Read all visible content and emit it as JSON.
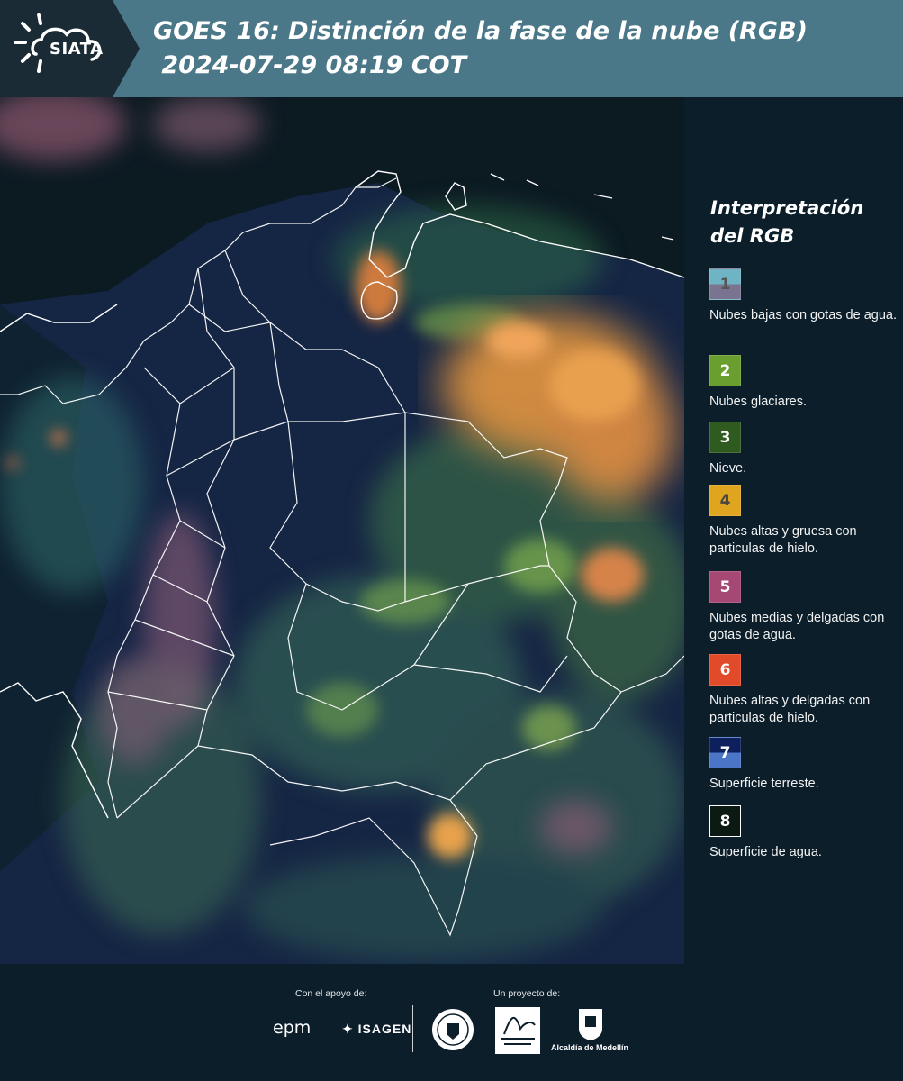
{
  "header": {
    "logo_text": "SIATA",
    "title_line1": "GOES 16: Distinción de la fase de la nube (RGB)",
    "title_line2": " 2024-07-29 08:19 COT",
    "background_color": "#4a7888"
  },
  "map": {
    "description_icon": "satellite-rgb-map",
    "palette": {
      "ocean": "#0c1a22",
      "land": "#1b2a48",
      "cloud_green": "#5c9a4c",
      "cloud_orange": "#e9a24a",
      "cloud_pink": "#a16a86",
      "border": "#ffffff"
    }
  },
  "legend": {
    "title": "Interpretación del RGB",
    "items": [
      {
        "number": "1",
        "label": "Nubes bajas con gotas de agua.",
        "color_top": "#6fb4c4",
        "color_bottom": "#7a7490",
        "number_color": "#555"
      },
      {
        "number": "2",
        "label": "Nubes glaciares.",
        "color_top": "#6a9e2e",
        "color_bottom": "#6a9e2e",
        "number_color": "#ffffff"
      },
      {
        "number": "3",
        "label": "Nieve.",
        "color_top": "#2f5b20",
        "color_bottom": "#2f5b20",
        "number_color": "#ffffff"
      },
      {
        "number": "4",
        "label": "Nubes altas y gruesa con particulas de hielo.",
        "color_top": "#e0a51e",
        "color_bottom": "#e0a51e",
        "number_color": "#444"
      },
      {
        "number": "5",
        "label": "Nubes medias y delgadas con gotas de agua.",
        "color_top": "#a54874",
        "color_bottom": "#a54874",
        "number_color": "#ffffff"
      },
      {
        "number": "6",
        "label": "Nubes altas y delgadas con particulas de hielo.",
        "color_top": "#e24b2a",
        "color_bottom": "#e24b2a",
        "number_color": "#ffffff"
      },
      {
        "number": "7",
        "label": "Superficie terreste.",
        "color_top": "#0d1f5c",
        "color_bottom": "#4b75c6",
        "number_color": "#ffffff"
      },
      {
        "number": "8",
        "label": "Superficie de agua.",
        "color_top": "#0c1a14",
        "color_bottom": "#0c1a14",
        "number_color": "#ffffff"
      }
    ]
  },
  "footer": {
    "support_caption": "Con el apoyo de:",
    "project_caption": "Un proyecto de:",
    "sponsor_epm": "epm",
    "sponsor_isagen": "ISAGEN",
    "partner_alcaldia": "Alcaldía de Medellín"
  }
}
